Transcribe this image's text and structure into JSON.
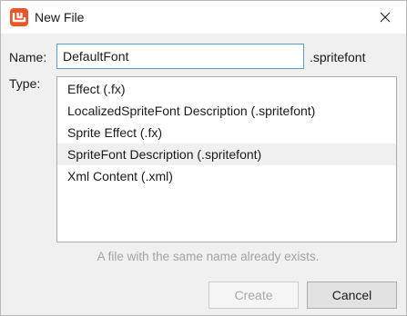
{
  "window": {
    "title": "New File",
    "accent_color": "#e8562a"
  },
  "form": {
    "name_label": "Name:",
    "name_value": "DefaultFont",
    "extension": ".spritefont",
    "type_label": "Type:"
  },
  "type_list": {
    "items": [
      {
        "label": "Effect (.fx)",
        "selected": false
      },
      {
        "label": "LocalizedSpriteFont Description (.spritefont)",
        "selected": false
      },
      {
        "label": "Sprite Effect (.fx)",
        "selected": false
      },
      {
        "label": "SpriteFont Description (.spritefont)",
        "selected": true
      },
      {
        "label": "Xml Content (.xml)",
        "selected": false
      }
    ]
  },
  "status": {
    "message": "A file with the same name already exists."
  },
  "buttons": {
    "create_label": "Create",
    "create_enabled": false,
    "cancel_label": "Cancel"
  },
  "icons": {
    "app": "monogame-logo-icon",
    "close": "close-icon"
  }
}
